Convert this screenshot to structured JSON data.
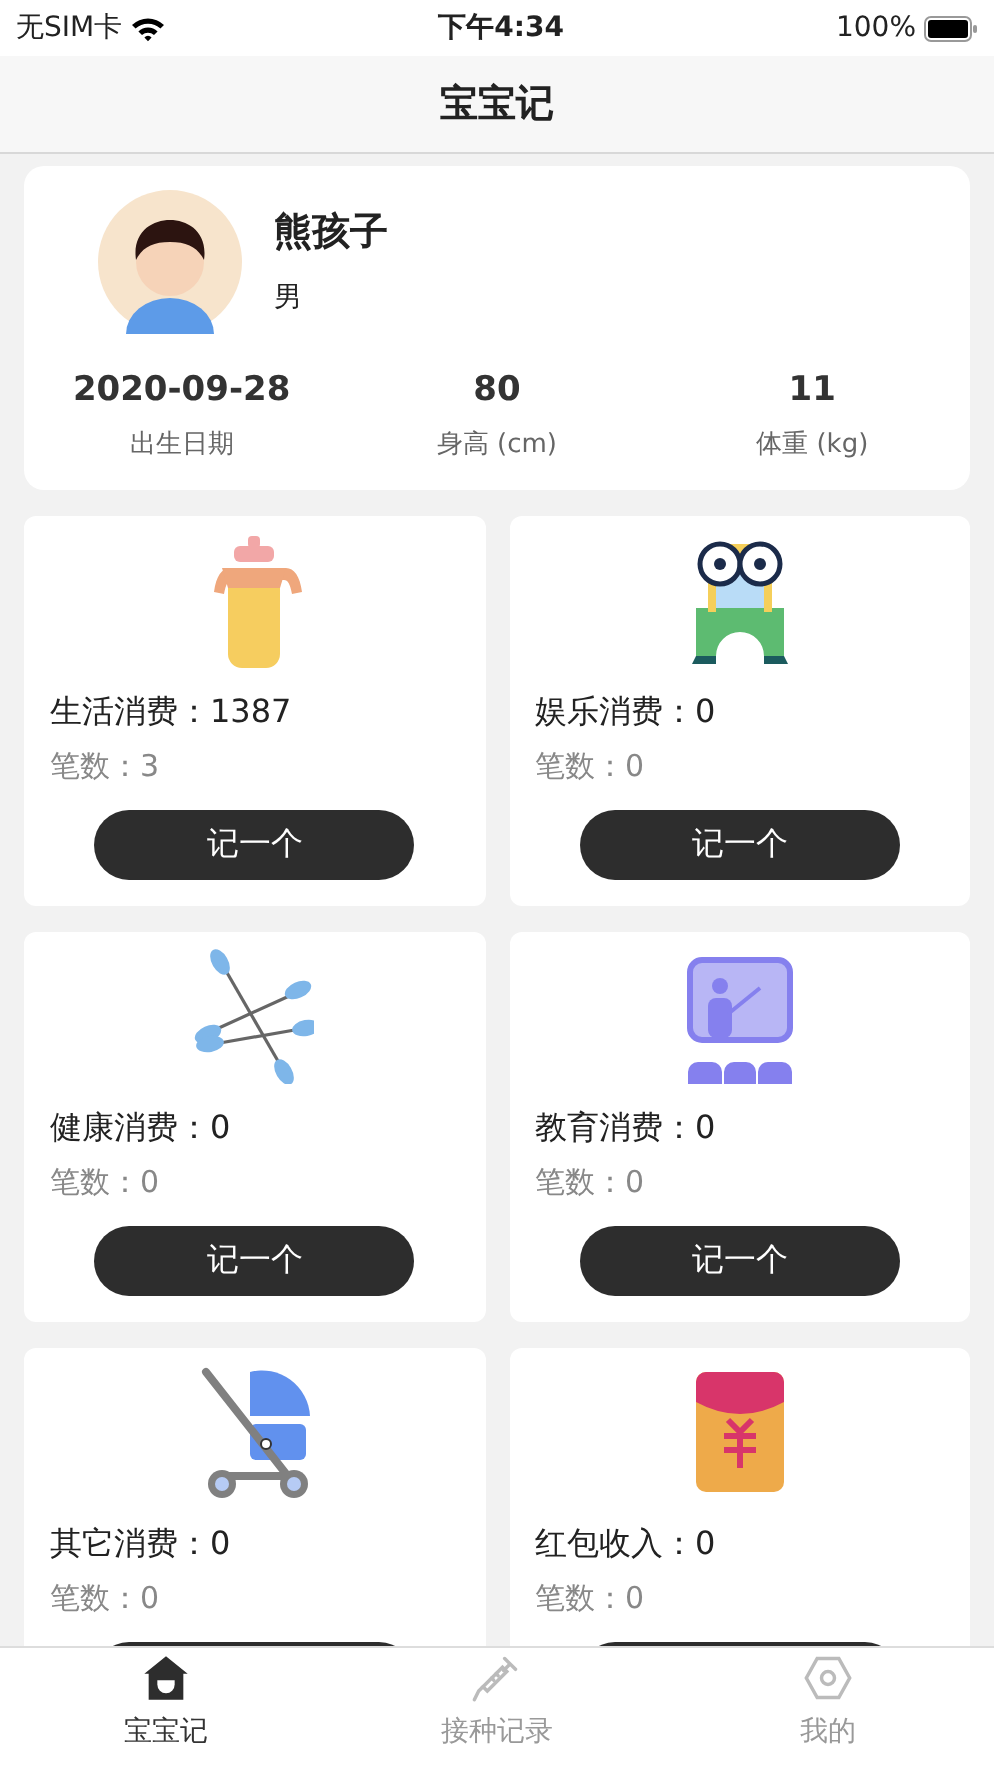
{
  "status_bar": {
    "carrier": "无SIM卡",
    "time": "下午4:34",
    "battery": "100%"
  },
  "nav": {
    "title": "宝宝记"
  },
  "profile": {
    "name": "熊孩子",
    "gender": "男",
    "stats": [
      {
        "value": "2020-09-28",
        "label": "出生日期"
      },
      {
        "value": "80",
        "label": "身高 (cm)"
      },
      {
        "value": "11",
        "label": "体重 (kg)"
      }
    ]
  },
  "categories": [
    {
      "kind": "bottle",
      "title": "生活消费：1387",
      "count": "笔数：3",
      "button": "记一个"
    },
    {
      "kind": "toy",
      "title": "娱乐消费：0",
      "count": "笔数：0",
      "button": "记一个"
    },
    {
      "kind": "swab",
      "title": "健康消费：0",
      "count": "笔数：0",
      "button": "记一个"
    },
    {
      "kind": "class",
      "title": "教育消费：0",
      "count": "笔数：0",
      "button": "记一个"
    },
    {
      "kind": "stroller",
      "title": "其它消费：0",
      "count": "笔数：0"
    },
    {
      "kind": "envelope",
      "title": "红包收入：0",
      "count": "笔数：0"
    }
  ],
  "tabs": [
    {
      "kind": "home",
      "label": "宝宝记",
      "selected": true
    },
    {
      "kind": "syringe",
      "label": "接种记录",
      "selected": false
    },
    {
      "kind": "hexagon",
      "label": "我的",
      "selected": false
    }
  ]
}
